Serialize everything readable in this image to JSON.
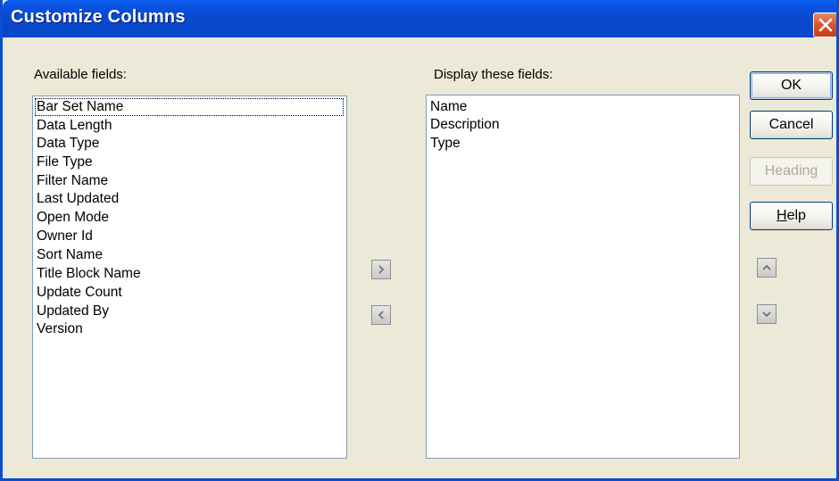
{
  "window": {
    "title": "Customize Columns"
  },
  "available": {
    "label": "Available fields:",
    "items": [
      "Bar Set Name",
      "Data Length",
      "Data Type",
      "File Type",
      "Filter Name",
      "Last Updated",
      "Open Mode",
      "Owner Id",
      "Sort Name",
      "Title Block Name",
      "Update Count",
      "Updated By",
      "Version"
    ],
    "focused_item": "Bar Set Name"
  },
  "display": {
    "label": "Display these fields:",
    "items": [
      "Name",
      "Description",
      "Type"
    ]
  },
  "buttons": {
    "ok": "OK",
    "cancel": "Cancel",
    "heading": "Heading",
    "help_mnemonic": "H",
    "help_rest": "elp"
  },
  "icons": {
    "close": "close-icon",
    "add": "chevron-right-icon",
    "remove": "chevron-left-icon",
    "move_up": "chevron-up-icon",
    "move_down": "chevron-down-icon"
  },
  "colors": {
    "titlebar": "#0a4bd3",
    "close": "#d9542a",
    "dialog_bg": "#ece9d8"
  }
}
